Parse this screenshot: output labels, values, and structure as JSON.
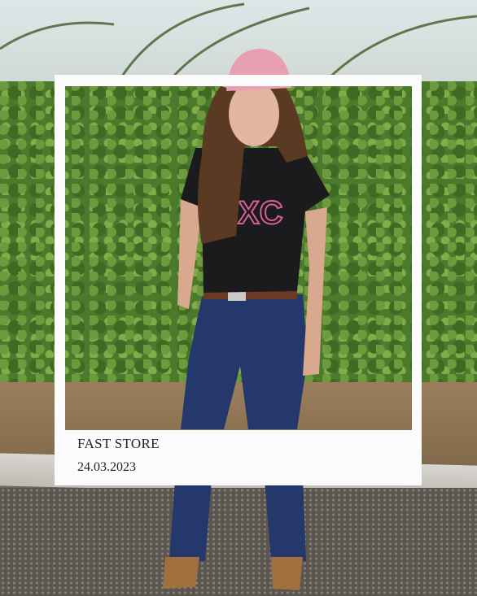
{
  "caption": {
    "title": "FAST STORE",
    "date": "24.03.2023"
  },
  "colors": {
    "frame": "#fbfbfb",
    "hedge": "#4c7a2c",
    "shirt": "#1b1b1d",
    "jeans": "#24386b",
    "cap": "#e79fb1"
  }
}
